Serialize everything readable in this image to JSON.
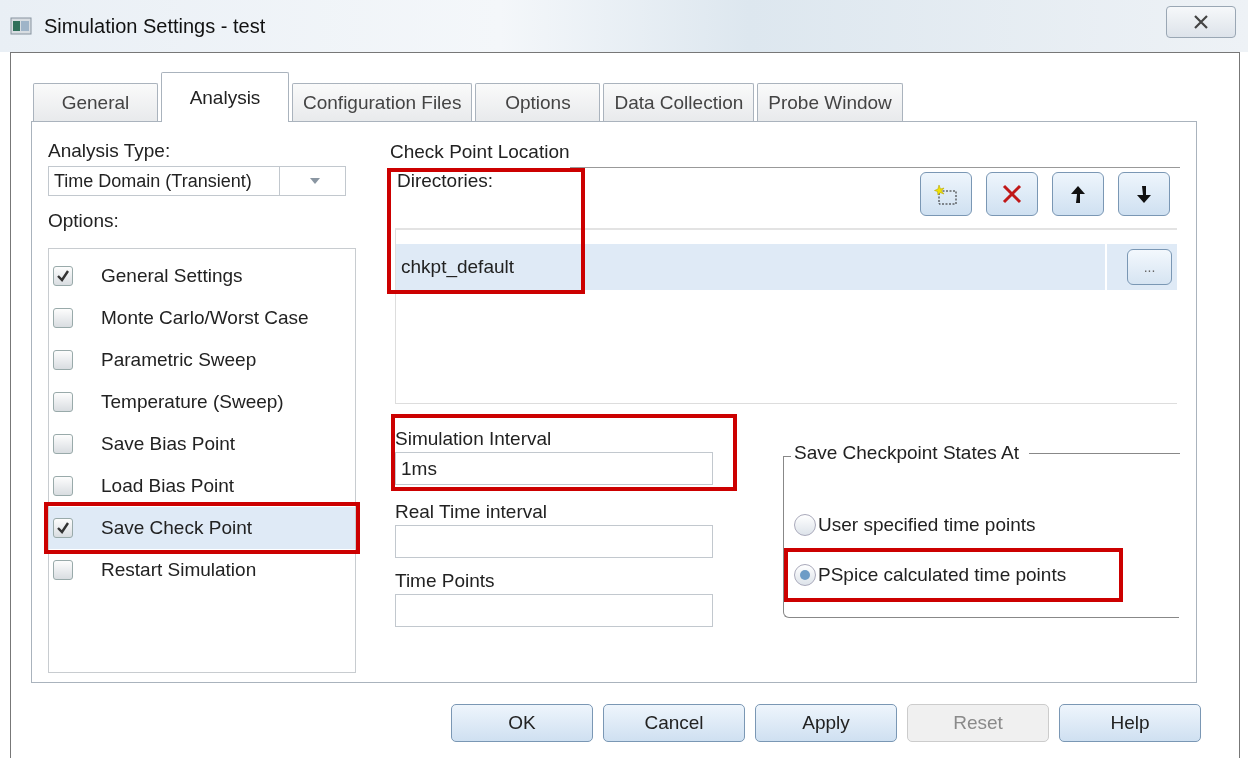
{
  "window": {
    "title": "Simulation Settings - test"
  },
  "tabs": [
    {
      "label": "General",
      "selected": false
    },
    {
      "label": "Analysis",
      "selected": true
    },
    {
      "label": "Configuration Files",
      "selected": false
    },
    {
      "label": "Options",
      "selected": false
    },
    {
      "label": "Data Collection",
      "selected": false
    },
    {
      "label": "Probe Window",
      "selected": false
    }
  ],
  "analysis_type": {
    "label": "Analysis Type:",
    "value": "Time Domain (Transient)"
  },
  "options": {
    "label": "Options:",
    "items": [
      {
        "label": "General Settings",
        "checked": true,
        "selected": false,
        "highlighted": false
      },
      {
        "label": "Monte Carlo/Worst Case",
        "checked": false,
        "selected": false,
        "highlighted": false
      },
      {
        "label": "Parametric Sweep",
        "checked": false,
        "selected": false,
        "highlighted": false
      },
      {
        "label": "Temperature (Sweep)",
        "checked": false,
        "selected": false,
        "highlighted": false
      },
      {
        "label": "Save Bias Point",
        "checked": false,
        "selected": false,
        "highlighted": false
      },
      {
        "label": "Load Bias Point",
        "checked": false,
        "selected": false,
        "highlighted": false
      },
      {
        "label": "Save Check Point",
        "checked": true,
        "selected": true,
        "highlighted": true
      },
      {
        "label": "Restart Simulation",
        "checked": false,
        "selected": false,
        "highlighted": false
      }
    ]
  },
  "check_point_location": {
    "title": "Check Point Location",
    "directories_label": "Directories:",
    "highlighted": true,
    "directories": [
      {
        "path": "chkpt_default",
        "selected": true,
        "browse": "..."
      }
    ]
  },
  "fields": [
    {
      "label": "Simulation Interval",
      "value": "1ms",
      "highlighted": true
    },
    {
      "label": "Real Time interval",
      "highlighted": false
    },
    {
      "label": "Time Points",
      "highlighted": false
    }
  ],
  "save_states": {
    "title": "Save Checkpoint States At",
    "options": [
      {
        "label": "User specified time points",
        "selected": false,
        "highlighted": false
      },
      {
        "label": "PSpice calculated time points",
        "selected": true,
        "highlighted": true
      }
    ]
  },
  "buttons": [
    {
      "label": "OK",
      "disabled": false
    },
    {
      "label": "Cancel",
      "disabled": false
    },
    {
      "label": "Apply",
      "disabled": false
    },
    {
      "label": "Reset",
      "disabled": true
    },
    {
      "label": "Help",
      "disabled": false
    }
  ]
}
